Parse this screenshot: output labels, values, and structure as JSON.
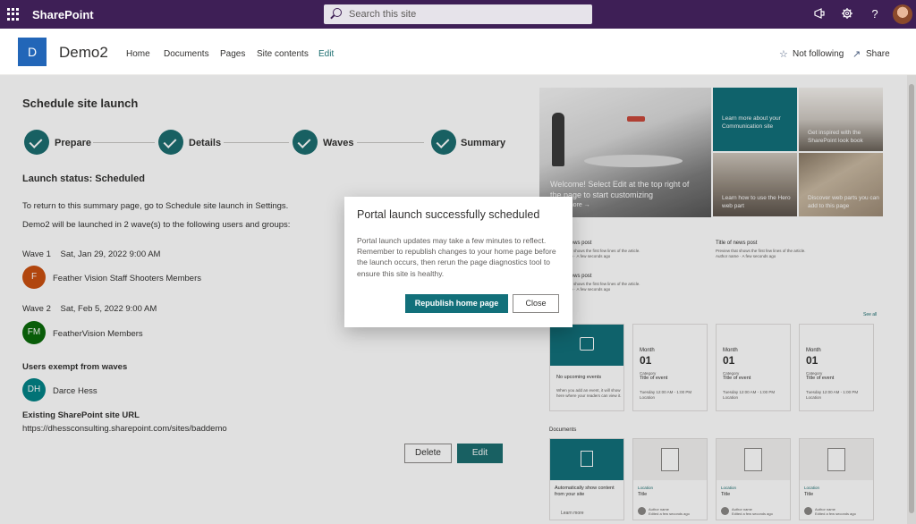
{
  "suite": {
    "brand": "SharePoint",
    "search_placeholder": "Search this site",
    "icons": [
      "waffle-icon",
      "megaphone-icon",
      "gear-icon",
      "help-icon"
    ]
  },
  "site": {
    "logo_letter": "D",
    "title": "Demo2",
    "nav": [
      "Home",
      "Documents",
      "Pages",
      "Site contents",
      "Edit"
    ],
    "follow": "Not following",
    "share": "Share"
  },
  "panel": {
    "title": "Schedule site launch",
    "steps": [
      "Prepare",
      "Details",
      "Waves",
      "Summary"
    ],
    "status": "Launch status: Scheduled",
    "para1": "To return to this summary page, go to Schedule site launch in Settings.",
    "para2": "Demo2 will be launched in 2 wave(s) to the following users and groups:",
    "wave1": {
      "label": "Wave 1",
      "date": "Sat, Jan 29, 2022 9:00 AM",
      "initials": "F",
      "name": "Feather Vision Staff Shooters Members",
      "color": "#ca5010"
    },
    "wave2": {
      "label": "Wave 2",
      "date": "Sat, Feb 5, 2022 9:00 AM",
      "initials": "FM",
      "name": "FeatherVision Members",
      "color": "#0b6a0b"
    },
    "exempt_title": "Users exempt from waves",
    "exempt": {
      "initials": "DH",
      "name": "Darce Hess",
      "color": "#038387"
    },
    "url_title": "Existing SharePoint site URL",
    "url": "https://dhessconsulting.sharepoint.com/sites/baddemo",
    "delete": "Delete",
    "edit": "Edit"
  },
  "preview": {
    "hero_caption": "Welcome! Select Edit at the top right of the page to start customizing",
    "hero_link": "Learn more →",
    "tiles": [
      "Learn more about your Communication site",
      "Get inspired with the SharePoint look book",
      "Learn how to use the Hero web part",
      "Discover web parts you can add to this page"
    ],
    "news": [
      {
        "title": "Title of news post",
        "sub": "Preview that shows the first few lines of the article.",
        "meta": "Author name · A few seconds ago"
      },
      {
        "title": "Title of news post",
        "sub": "Preview that shows the first few lines of the article.",
        "meta": "Author name · A few seconds ago"
      },
      {
        "title": "Title of news post",
        "sub": "Preview that shows the first few lines of the article.",
        "meta": "Author name · A few seconds ago"
      }
    ],
    "see_all": "See all",
    "no_events": "No upcoming events",
    "no_events_sub": "When you add an event, it will show here where your readers can view it.",
    "event": {
      "month": "Month",
      "day": "01",
      "category": "Category",
      "title": "Title of event",
      "time": "Tuesday 12:00 AM - 1:00 PM",
      "location": "Location"
    },
    "documents": "Documents",
    "doc_auto": "Automatically show content from your site",
    "doc_learn": "Learn more",
    "doc": {
      "location": "Location",
      "title": "Title",
      "author": "Author name",
      "edited": "Edited a few seconds ago"
    }
  },
  "dialog": {
    "title": "Portal launch successfully scheduled",
    "body": "Portal launch updates may take a few minutes to reflect. Remember to republish changes to your home page before the launch occurs, then rerun the page diagnostics tool to ensure this site is healthy.",
    "primary": "Republish home page",
    "close": "Close"
  }
}
